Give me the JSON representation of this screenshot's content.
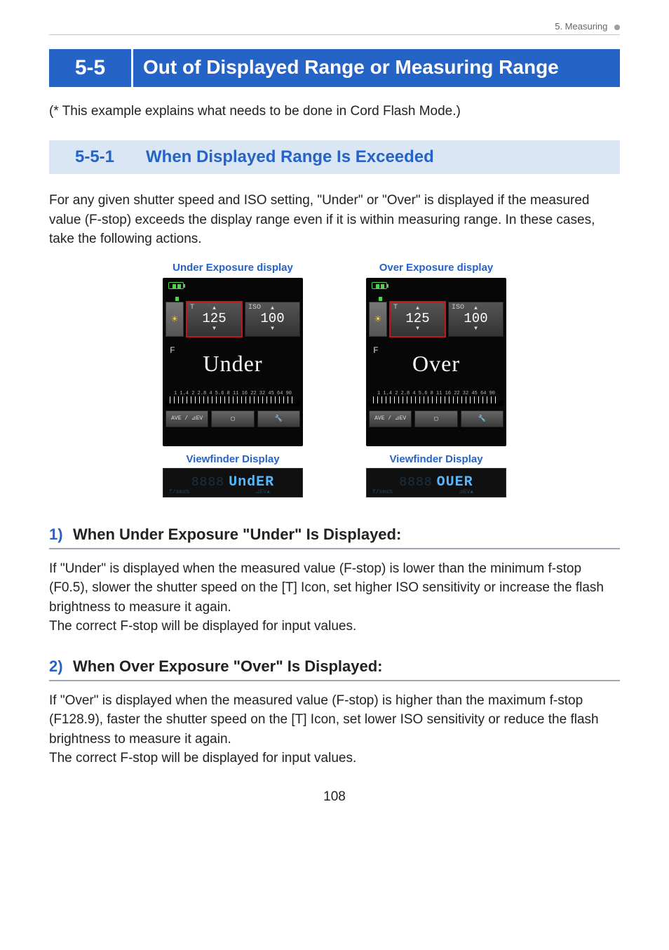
{
  "runningHead": {
    "text": "5.  Measuring"
  },
  "main": {
    "number": "5-5",
    "title": "Out of Displayed Range or Measuring Range"
  },
  "note": "(* This example explains what needs to be done in Cord Flash Mode.)",
  "sub": {
    "number": "5-5-1",
    "title": "When Displayed Range Is Exceeded"
  },
  "introPara": "For any given shutter speed and ISO setting, \"Under\" or \"Over\" is displayed if the measured value (F-stop) exceeds the display range even if it is within measuring range. In these cases, take the following actions.",
  "displays": {
    "scaleLabels": "1  1.4  2  2.8  4  5.6  8   11 16 22 32 45 64 90",
    "under": {
      "caption": "Under Exposure display",
      "tLabel": "T",
      "tValue": "125",
      "isoLabel": "ISO",
      "isoValue": "100",
      "big": "Under",
      "fLabel": "F",
      "botAve": "AVE /",
      "botEv": "⊿EV",
      "vfCaption": "Viewfinder Display",
      "vfDim": "8888",
      "vfBright": "UndER",
      "vfSmall1": "f/sms%",
      "vfSmall2": "⊿EV▲"
    },
    "over": {
      "caption": "Over Exposure display",
      "tLabel": "T",
      "tValue": "125",
      "isoLabel": "ISO",
      "isoValue": "100",
      "big": "Over",
      "fLabel": "F",
      "botAve": "AVE /",
      "botEv": "⊿EV",
      "vfCaption": "Viewfinder Display",
      "vfDim": "8888",
      "vfBright": "OUER",
      "vfSmall1": "f/sms%",
      "vfSmall2": "⊿EV▲"
    }
  },
  "step1": {
    "num": "1)",
    "title": "When Under Exposure \"Under\" Is Displayed:",
    "body1": "If \"Under\" is displayed when the measured value (F-stop) is lower than the minimum f-stop (F0.5), slower the shutter speed on the [T] Icon, set higher ISO sensitivity or increase the flash brightness to measure it again.",
    "body2": "The correct F-stop will be displayed for input values."
  },
  "step2": {
    "num": "2)",
    "title": "When Over Exposure \"Over\" Is Displayed:",
    "body1": "If \"Over\" is displayed when the measured value (F-stop) is higher than the maximum f-stop (F128.9), faster the shutter speed on the [T] Icon, set lower ISO sensitivity or reduce the flash brightness to measure it again.",
    "body2": "The correct F-stop will be displayed for input values."
  },
  "pageNumber": "108"
}
